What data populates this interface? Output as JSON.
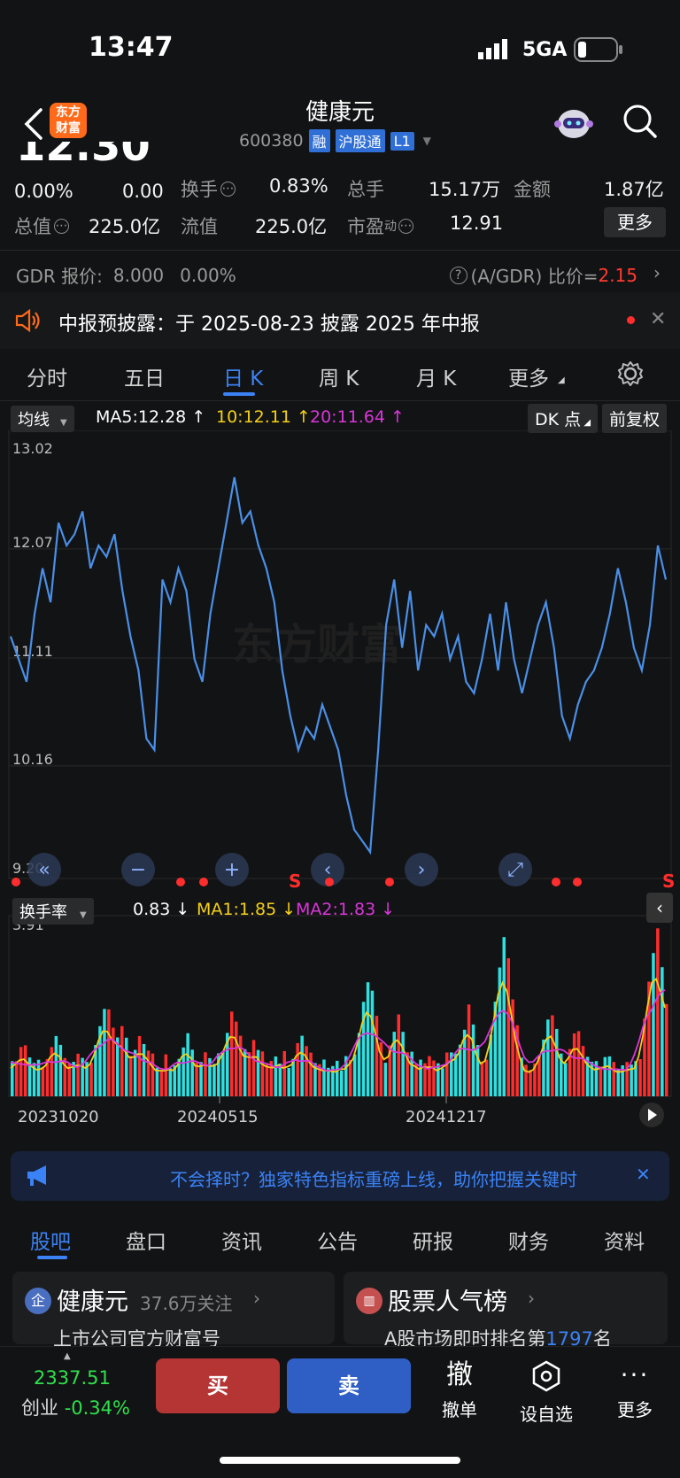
{
  "status_bar": {
    "time": "13:47",
    "network": "5GA"
  },
  "header": {
    "logo_line1": "东方",
    "logo_line2": "财富",
    "stock_name": "健康元",
    "stock_code": "600380",
    "tags": [
      "融",
      "沪股通",
      "L1"
    ]
  },
  "quote": {
    "price": "12.30",
    "change_pct": "0.00%",
    "change": "0.00",
    "turnover_label": "换手",
    "turnover_value": "0.83%",
    "total_vol_label": "总手",
    "total_vol_value": "15.17万",
    "amount_label": "金额",
    "amount_value": "1.87亿",
    "total_cap_label": "总值",
    "total_cap_value": "225.0亿",
    "float_cap_label": "流值",
    "float_cap_value": "225.0亿",
    "pe_label": "市盈",
    "pe_super": "动",
    "pe_value": "12.91",
    "more_label": "更多"
  },
  "gdr": {
    "label": "GDR 报价:",
    "price": "8.000",
    "pct": "0.00%",
    "ratio_label": "(A/GDR) 比价=",
    "ratio_value": "2.15"
  },
  "notice": {
    "text": "中报预披露：于 2025-08-23 披露 2025 年中报"
  },
  "period_tabs": [
    "分时",
    "五日",
    "日 K",
    "周 K",
    "月 K",
    "更多"
  ],
  "ma_row": {
    "select": "均线",
    "ma5": "MA5:12.28",
    "ma10": "10:12.11",
    "ma20": "20:11.64",
    "dk_label": "DK 点",
    "fq_label": "前复权",
    "ma5_color": "#ffffff",
    "ma10_color": "#f5d017",
    "ma20_color": "#d936d9"
  },
  "indicator_row": {
    "select": "换手率",
    "value": "0.83",
    "ma1": "MA1:1.85",
    "ma2": "MA2:1.83"
  },
  "chart_data": {
    "type": "line",
    "title": "",
    "y_ticks": [
      "13.02",
      "12.07",
      "11.11",
      "10.16",
      "9.20"
    ],
    "ylim": [
      9.2,
      13.02
    ],
    "x_ticks": [
      "20231020",
      "20240515",
      "20241217"
    ],
    "series": [
      {
        "values": [
          11.3,
          11.1,
          10.9,
          11.5,
          11.9,
          11.6,
          12.3,
          12.1,
          12.2,
          12.4,
          11.9,
          12.1,
          12.0,
          12.2,
          11.7,
          11.3,
          11.0,
          10.4,
          10.3,
          11.8,
          11.6,
          11.9,
          11.7,
          11.1,
          10.9,
          11.5,
          11.9,
          12.3,
          12.7,
          12.3,
          12.4,
          12.1,
          11.9,
          11.6,
          11.0,
          10.6,
          10.3,
          10.5,
          10.4,
          10.7,
          10.5,
          10.3,
          9.9,
          9.6,
          9.5,
          9.4,
          10.3,
          11.4,
          11.8,
          11.2,
          11.7,
          11.0,
          11.4,
          11.3,
          11.5,
          11.1,
          11.3,
          10.9,
          10.8,
          11.1,
          11.5,
          11.0,
          11.6,
          11.1,
          10.8,
          11.1,
          11.4,
          11.6,
          11.2,
          10.6,
          10.4,
          10.7,
          10.9,
          11.0,
          11.2,
          11.5,
          11.9,
          11.6,
          11.2,
          11.0,
          11.4,
          12.1,
          11.8
        ]
      }
    ],
    "volume_top_label": "3.91"
  },
  "ad_banner": {
    "text": "不会择时？独家特色指标重磅上线，助你把握关键时"
  },
  "bottom_tabs": [
    "股吧",
    "盘口",
    "资讯",
    "公告",
    "研报",
    "财务",
    "资料"
  ],
  "cards": {
    "left_title": "健康元",
    "left_follow": "37.6万关注",
    "left_sub": "上市公司官方财富号",
    "right_title": "股票人气榜",
    "right_sub_prefix": "A股市场即时排名第",
    "right_rank": "1797",
    "right_sub_suffix": "名"
  },
  "bottom_bar": {
    "index_value": "2337.51",
    "index_name": "创业",
    "index_change": "-0.34%",
    "buy": "买",
    "sell": "卖",
    "cancel_glyph": "撤",
    "cancel_label": "撤单",
    "watch_label": "设自选",
    "more_label": "更多"
  }
}
